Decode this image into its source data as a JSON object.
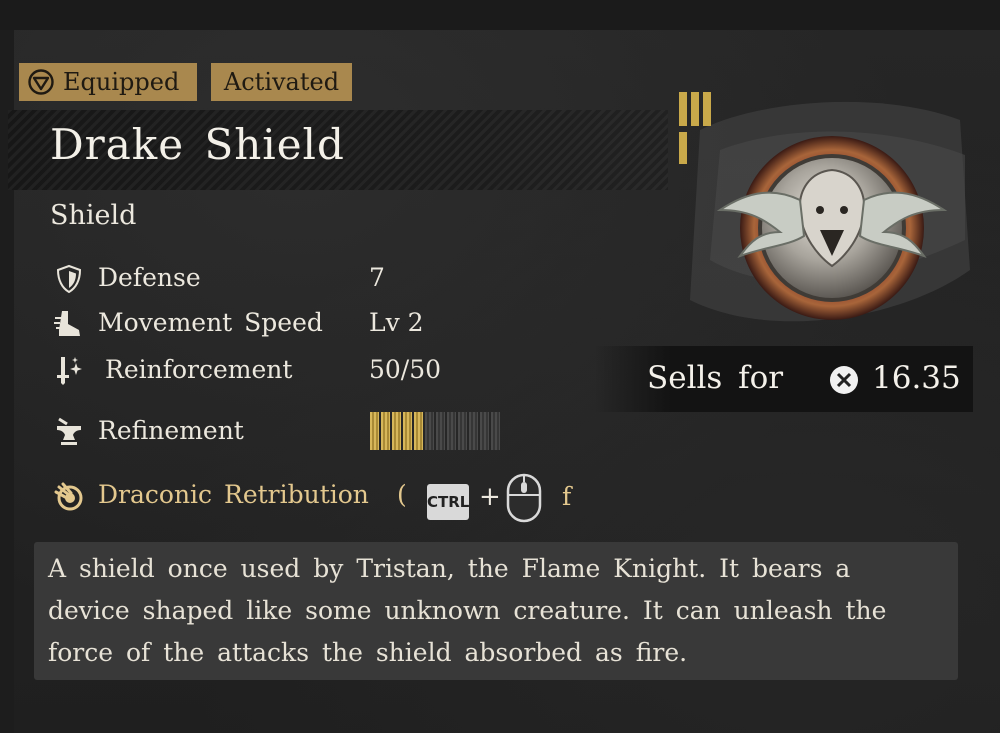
{
  "badges": {
    "equipped": "Equipped",
    "activated": "Activated"
  },
  "item": {
    "name": "Drake Shield",
    "category": "Shield"
  },
  "stats": [
    {
      "icon": "shield-defense-icon",
      "label": "Defense",
      "value": "7"
    },
    {
      "icon": "boot-speed-icon",
      "label": "Movement Speed",
      "value": "Lv 2"
    },
    {
      "icon": "reinforcement-icon",
      "label": "Reinforcement",
      "value": "50/50"
    },
    {
      "icon": "anvil-refinement-icon",
      "label": "Refinement"
    }
  ],
  "refinement": {
    "filled": 5,
    "total": 12
  },
  "skill": {
    "icon": "claw-skill-icon",
    "name": "Draconic Retribution",
    "open_paren": "(",
    "key_ctrl": "CTRL",
    "plus": "+",
    "key_suffix": "f"
  },
  "sell": {
    "label": "Sells for",
    "value": "16.35"
  },
  "description": "A shield once used by Tristan, the Flame Knight. It bears a device shaped like some unknown creature. It can unleash the force of the attacks the shield absorbed as fire.",
  "colors": {
    "badge": "#a9884e",
    "skill": "#e3c88e",
    "refine_on": "#d7b75a",
    "refine_off": "#4a4a4a"
  }
}
